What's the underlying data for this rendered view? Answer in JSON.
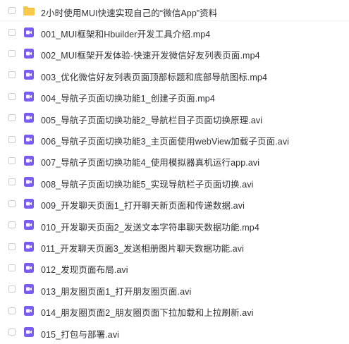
{
  "colors": {
    "folder": "#f7c84a",
    "video": "#7b5cf0",
    "text": "#2f3033"
  },
  "items": [
    {
      "type": "folder",
      "icon": "folder-icon",
      "name": "2小时使用MUI快速实现自己的“微信App”资料"
    },
    {
      "type": "video",
      "icon": "video-file-icon",
      "name": "001_MUI框架和Hbuilder开发工具介绍.mp4"
    },
    {
      "type": "video",
      "icon": "video-file-icon",
      "name": "002_MUI框架开发体验-快速开发微信好友列表页面.mp4"
    },
    {
      "type": "video",
      "icon": "video-file-icon",
      "name": "003_优化微信好友列表页面顶部标题和底部导航图标.mp4"
    },
    {
      "type": "video",
      "icon": "video-file-icon",
      "name": "004_导航子页面切换功能1_创建子页面.mp4"
    },
    {
      "type": "video",
      "icon": "video-file-icon",
      "name": "005_导航子页面切换功能2_导航栏目子页面切换原理.avi"
    },
    {
      "type": "video",
      "icon": "video-file-icon",
      "name": "006_导航子页面切换功能3_主页面使用webView加载子页面.avi"
    },
    {
      "type": "video",
      "icon": "video-file-icon",
      "name": "007_导航子页面切换功能4_使用模拟器真机运行app.avi"
    },
    {
      "type": "video",
      "icon": "video-file-icon",
      "name": "008_导航子页面切换功能5_实现导航栏子页面切换.avi"
    },
    {
      "type": "video",
      "icon": "video-file-icon",
      "name": "009_开发聊天页面1_打开聊天新页面和传递数据.avi"
    },
    {
      "type": "video",
      "icon": "video-file-icon",
      "name": "010_开发聊天页面2_发送文本字符串聊天数据功能.mp4"
    },
    {
      "type": "video",
      "icon": "video-file-icon",
      "name": "011_开发聊天页面3_发送相册图片聊天数据功能.avi"
    },
    {
      "type": "video",
      "icon": "video-file-icon",
      "name": "012_发现页面布局.avi"
    },
    {
      "type": "video",
      "icon": "video-file-icon",
      "name": "013_朋友圈页面1_打开朋友圈页面.avi"
    },
    {
      "type": "video",
      "icon": "video-file-icon",
      "name": "014_朋友圈页面2_朋友圈页面下拉加载和上拉刷新.avi"
    },
    {
      "type": "video",
      "icon": "video-file-icon",
      "name": "015_打包与部署.avi"
    }
  ]
}
